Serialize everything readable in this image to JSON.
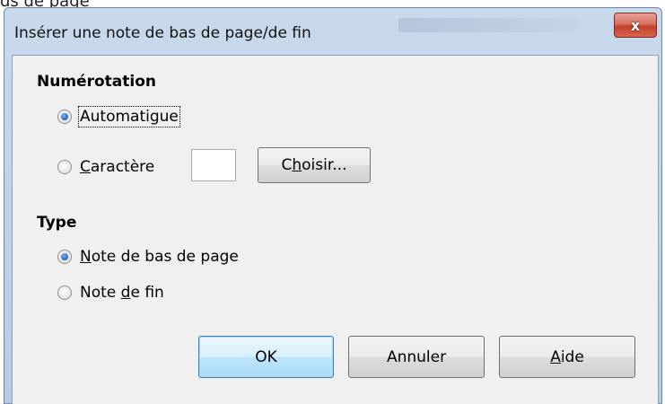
{
  "background_fragment": "ds de page",
  "window": {
    "title": "Insérer une note de bas de page/de fin",
    "close_label": "x"
  },
  "numbering": {
    "heading": "Numérotation",
    "automatic": {
      "before": "Automati",
      "ul": "g",
      "after": "ue",
      "selected": true
    },
    "character": {
      "before": "",
      "ul": "C",
      "after": "aractère",
      "selected": false,
      "value": ""
    },
    "choose_button": {
      "before": "C",
      "ul": "h",
      "after": "oisir..."
    }
  },
  "type": {
    "heading": "Type",
    "footnote": {
      "before": "",
      "ul": "N",
      "after": "ote de bas de page",
      "selected": true
    },
    "endnote": {
      "before": "Note ",
      "ul": "d",
      "after": "e fin",
      "selected": false
    }
  },
  "buttons": {
    "ok": "OK",
    "cancel": "Annuler",
    "help": {
      "before": "",
      "ul": "A",
      "after": "ide"
    }
  }
}
